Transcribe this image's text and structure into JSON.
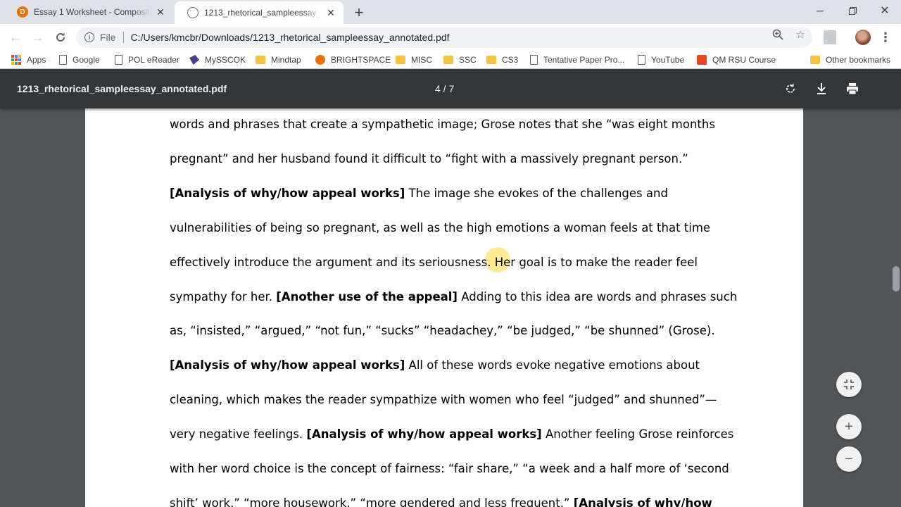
{
  "tabs": [
    {
      "title": "Essay 1 Worksheet - Composition",
      "icon": "d2l-icon",
      "active": false
    },
    {
      "title": "1213_rhetorical_sampleessay_annotated.pdf",
      "icon": "document-icon",
      "active": true
    }
  ],
  "omnibox": {
    "scheme": "File",
    "url": "C:/Users/kmcbr/Downloads/1213_rhetorical_sampleessay_annotated.pdf"
  },
  "bookmarks": [
    {
      "label": "Apps",
      "icon": "apps-icon"
    },
    {
      "label": "Google",
      "icon": "page-icon"
    },
    {
      "label": "POL eReader",
      "icon": "page-icon"
    },
    {
      "label": "MySSCOK",
      "icon": "sscok-icon"
    },
    {
      "label": "Mindtap",
      "icon": "folder-icon"
    },
    {
      "label": "BRIGHTSPACE",
      "icon": "d2l-icon"
    },
    {
      "label": "MISC",
      "icon": "folder-icon"
    },
    {
      "label": "SSC",
      "icon": "folder-icon"
    },
    {
      "label": "CS3",
      "icon": "folder-icon"
    },
    {
      "label": "Tentative Paper Pro...",
      "icon": "page-icon"
    },
    {
      "label": "YouTube",
      "icon": "page-icon"
    },
    {
      "label": "QM RSU Course",
      "icon": "qm-icon"
    },
    {
      "label": "Other bookmarks",
      "icon": "folder-icon"
    }
  ],
  "pdf": {
    "title": "1213_rhetorical_sampleessay_annotated.pdf",
    "page_indicator": "4 / 7"
  },
  "document": {
    "lines": [
      {
        "segments": [
          {
            "text": "words and phrases that create a sympathetic image; Grose notes that she “was eight months",
            "bold": false
          }
        ]
      },
      {
        "segments": [
          {
            "text": "pregnant” and her husband found it difficult to “fight with a massively pregnant person.”",
            "bold": false
          }
        ]
      },
      {
        "segments": [
          {
            "text": "[Analysis of why/how appeal works]",
            "bold": true
          },
          {
            "text": " The image she evokes of the challenges and",
            "bold": false
          }
        ]
      },
      {
        "segments": [
          {
            "text": "vulnerabilities of being so pregnant, as well as the high emotions a woman feels at that time",
            "bold": false
          }
        ]
      },
      {
        "segments": [
          {
            "text": "effectively introduce the argument and its seriousness.  Her goal is to make the reader feel",
            "bold": false
          }
        ]
      },
      {
        "segments": [
          {
            "text": "sympathy for her. ",
            "bold": false
          },
          {
            "text": "[Another use of the appeal]",
            "bold": true
          },
          {
            "text": " Adding to this idea are words and phrases such",
            "bold": false
          }
        ]
      },
      {
        "segments": [
          {
            "text": "as, “insisted,” “argued,” “not fun,” “sucks” “headachey,” “be judged,” “be shunned” (Grose).",
            "bold": false
          }
        ]
      },
      {
        "segments": [
          {
            "text": "[Analysis of why/how appeal works]",
            "bold": true
          },
          {
            "text": " All of these words evoke negative emotions about",
            "bold": false
          }
        ]
      },
      {
        "segments": [
          {
            "text": "cleaning, which makes the reader sympathize with women who feel “judged” and shunned”—",
            "bold": false
          }
        ]
      },
      {
        "segments": [
          {
            "text": "very negative feelings. ",
            "bold": false
          },
          {
            "text": "[Analysis of why/how appeal works]",
            "bold": true
          },
          {
            "text": " Another feeling Grose reinforces",
            "bold": false
          }
        ]
      },
      {
        "segments": [
          {
            "text": "with her word choice is the concept of fairness: “fair share,” “a week and a half more of ‘second",
            "bold": false
          }
        ]
      },
      {
        "segments": [
          {
            "text": "shift’ work,” “more housework,” “more gendered and less frequent.” ",
            "bold": false
          },
          {
            "text": "[Analysis of why/how",
            "bold": true
          }
        ]
      }
    ]
  },
  "colors": {
    "tabstrip": "#dee1e6",
    "pdf_toolbar": "#323639",
    "pdf_background": "#525659",
    "cursor_highlight": "#ffe05a"
  }
}
